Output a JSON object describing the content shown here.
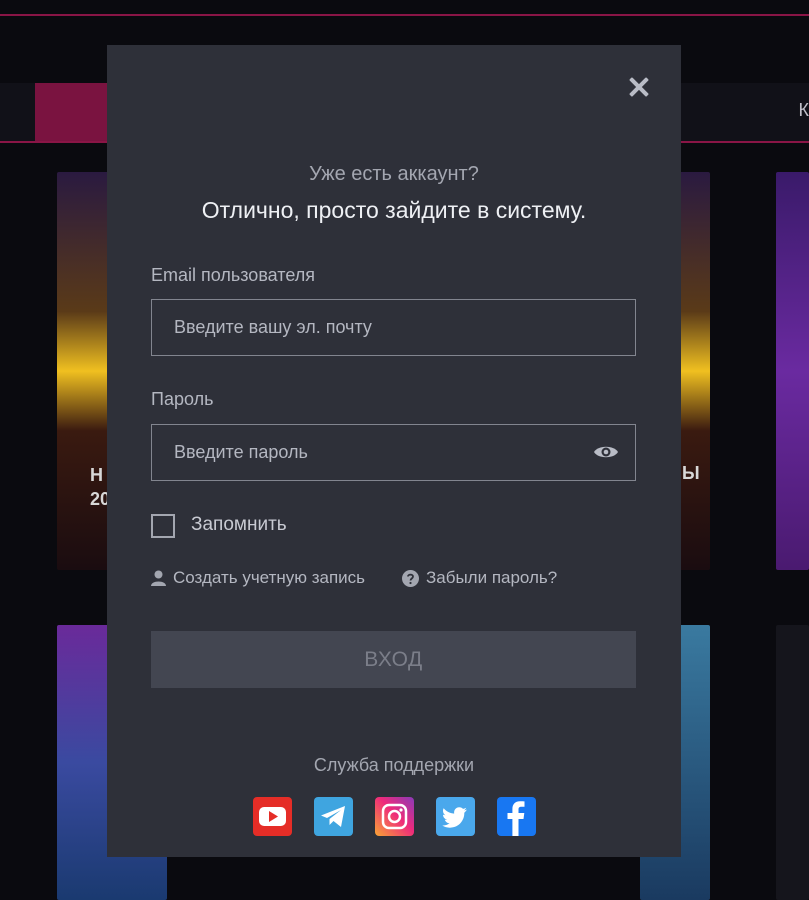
{
  "background": {
    "nav_letter": "К",
    "card_text_left": "Н\n20",
    "card_text_right": "Ы"
  },
  "modal": {
    "subtitle": "Уже есть аккаунт?",
    "title": "Отлично, просто зайдите в систему.",
    "email": {
      "label": "Email пользователя",
      "placeholder": "Введите вашу эл. почту",
      "value": ""
    },
    "password": {
      "label": "Пароль",
      "placeholder": "Введите пароль",
      "value": ""
    },
    "remember": {
      "label": "Запомнить",
      "checked": false
    },
    "links": {
      "create_account": "Создать учетную запись",
      "forgot_password": "Забыли пароль?"
    },
    "login_button": "ВХОД",
    "support": {
      "label": "Служба поддержки",
      "channels": [
        {
          "name": "youtube",
          "icon": "youtube-icon",
          "color": "#e52d27"
        },
        {
          "name": "telegram",
          "icon": "telegram-icon",
          "color": "#3fa5e0"
        },
        {
          "name": "instagram",
          "icon": "instagram-icon",
          "color": "#e4405f"
        },
        {
          "name": "twitter",
          "icon": "twitter-icon",
          "color": "#1da1f2"
        },
        {
          "name": "facebook",
          "icon": "facebook-icon",
          "color": "#1877f2"
        }
      ]
    }
  },
  "colors": {
    "modal_bg": "#2e3039",
    "accent": "#8a1546",
    "button_disabled": "#434651"
  }
}
